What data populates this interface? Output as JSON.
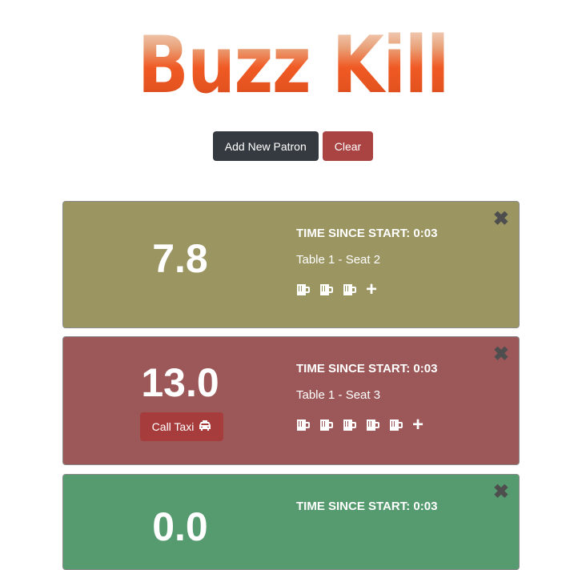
{
  "header": {
    "logo_text": "Buzz Kill"
  },
  "toolbar": {
    "add_label": "Add New Patron",
    "clear_label": "Clear"
  },
  "colors": {
    "yellow": "#9b9562",
    "red": "#9c5858",
    "green": "#559b6f"
  },
  "patrons": [
    {
      "bac": "7.8",
      "timer": "TIME SINCE START: 0:03",
      "seat": "Table 1 - Seat 2",
      "drinks": 3,
      "status": "yellow"
    },
    {
      "bac": "13.0",
      "timer": "TIME SINCE START: 0:03",
      "seat": "Table 1 - Seat 3",
      "drinks": 5,
      "status": "red",
      "taxi_label": "Call Taxi"
    },
    {
      "bac": "0.0",
      "timer": "TIME SINCE START: 0:03",
      "status": "green"
    }
  ]
}
